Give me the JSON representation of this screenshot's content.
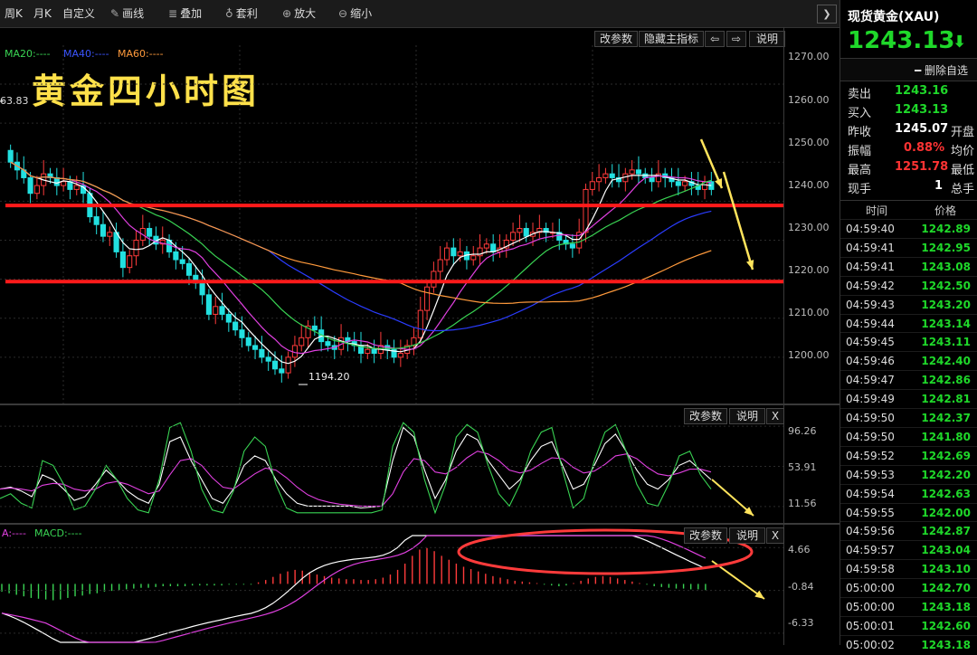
{
  "toolbar": {
    "weekly": "周K",
    "monthly": "月K",
    "custom": "自定义",
    "draw": "画线",
    "overlay": "叠加",
    "arbitrage": "套利",
    "zoom_in": "放大",
    "zoom_out": "缩小"
  },
  "main_panel": {
    "buttons": {
      "params": "改参数",
      "hide_indicator": "隐藏主指标",
      "explain": "说明"
    },
    "legend": {
      "ma20": "MA20:----",
      "ma40": "MA40:----",
      "ma60": "MA60:----"
    },
    "overlay_title": "黄金四小时图",
    "high_label": "63.83",
    "low_label": "1194.20"
  },
  "kd_panel": {
    "buttons": {
      "params": "改参数",
      "explain": "说明",
      "close": "X"
    },
    "y_ticks": [
      "96.26",
      "53.91",
      "11.56"
    ]
  },
  "macd_panel": {
    "buttons": {
      "params": "改参数",
      "explain": "说明",
      "close": "X"
    },
    "legend": {
      "a": "A:----",
      "macd": "MACD:----"
    },
    "y_ticks": [
      "4.66",
      "-0.84",
      "-6.33"
    ]
  },
  "colors": {
    "up": "#ff3b3b",
    "down": "#22e0e0",
    "ma20": "#39d353",
    "ma40": "#2a3cff",
    "ma60": "#ff9a3c",
    "fast": "#ffffff",
    "slow": "#e040e0",
    "green": "#39d353",
    "hline": "#ff1a1a",
    "arrow": "#ffe45c"
  },
  "quote": {
    "name": "现货黄金(XAU)",
    "price": "1243.13",
    "direction_icon": "arrow-down-icon",
    "remove_watch": "删除自选",
    "rows": [
      {
        "label": "卖出",
        "value": "1243.16",
        "extra": ""
      },
      {
        "label": "买入",
        "value": "1243.13",
        "extra": ""
      },
      {
        "label": "昨收",
        "value": "1245.07",
        "extra": "开盘"
      },
      {
        "label": "振幅",
        "value": "0.88%",
        "extra": "均价"
      },
      {
        "label": "最高",
        "value": "1251.78",
        "extra": "最低"
      },
      {
        "label": "现手",
        "value": "1",
        "extra": "总手"
      }
    ],
    "ticks_header": {
      "time": "时间",
      "price": "价格"
    },
    "ticks": [
      [
        "04:59:40",
        "1242.89"
      ],
      [
        "04:59:41",
        "1242.95"
      ],
      [
        "04:59:41",
        "1243.08"
      ],
      [
        "04:59:42",
        "1242.50"
      ],
      [
        "04:59:43",
        "1243.20"
      ],
      [
        "04:59:44",
        "1243.14"
      ],
      [
        "04:59:45",
        "1243.11"
      ],
      [
        "04:59:46",
        "1242.40"
      ],
      [
        "04:59:47",
        "1242.86"
      ],
      [
        "04:59:49",
        "1242.81"
      ],
      [
        "04:59:50",
        "1242.37"
      ],
      [
        "04:59:50",
        "1241.80"
      ],
      [
        "04:59:52",
        "1242.69"
      ],
      [
        "04:59:53",
        "1242.20"
      ],
      [
        "04:59:54",
        "1242.63"
      ],
      [
        "04:59:55",
        "1242.00"
      ],
      [
        "04:59:56",
        "1242.87"
      ],
      [
        "04:59:57",
        "1243.04"
      ],
      [
        "04:59:58",
        "1243.10"
      ],
      [
        "05:00:00",
        "1242.70"
      ],
      [
        "05:00:00",
        "1243.18"
      ],
      [
        "05:00:01",
        "1242.60"
      ],
      [
        "05:00:02",
        "1243.18"
      ]
    ]
  },
  "chart_data": [
    {
      "type": "candlestick",
      "y_ticks": [
        "1270.00",
        "1260.00",
        "1250.00",
        "1240.00",
        "1230.00",
        "1220.00",
        "1210.00",
        "1200.00"
      ],
      "ylim": [
        1190,
        1273
      ],
      "horizontal_lines": [
        1238.9,
        1219.4
      ],
      "series_names": [
        "MA20",
        "MA40",
        "MA60"
      ],
      "closes": [
        1250,
        1248,
        1246,
        1242,
        1244,
        1247,
        1246,
        1244,
        1245,
        1243,
        1244,
        1242,
        1236,
        1234,
        1231,
        1232,
        1227,
        1223,
        1226,
        1230,
        1233,
        1231,
        1229,
        1230,
        1227,
        1225,
        1224,
        1221,
        1219,
        1216,
        1211,
        1213,
        1211,
        1209,
        1207,
        1205,
        1203,
        1202,
        1200,
        1199,
        1197,
        1196,
        1200,
        1203,
        1205,
        1208,
        1207,
        1204,
        1203,
        1202,
        1205,
        1204,
        1203,
        1201,
        1202,
        1201,
        1203,
        1202,
        1200,
        1201,
        1203,
        1205,
        1212,
        1218,
        1222,
        1225,
        1228,
        1226,
        1227,
        1225,
        1226,
        1228,
        1229,
        1227,
        1228,
        1230,
        1232,
        1233,
        1231,
        1232,
        1233,
        1232,
        1232,
        1230,
        1229,
        1228,
        1232,
        1243,
        1245,
        1246,
        1247,
        1246,
        1245,
        1247,
        1248,
        1247,
        1246,
        1245,
        1247,
        1246,
        1245,
        1244,
        1245,
        1244,
        1243,
        1245,
        1243
      ]
    },
    {
      "type": "line",
      "name": "kd",
      "y_ticks": [
        "96.26",
        "53.91",
        "11.56"
      ],
      "ylim": [
        0,
        105
      ],
      "series": [
        {
          "name": "fast",
          "values": [
            30,
            32,
            28,
            22,
            45,
            40,
            30,
            18,
            22,
            35,
            50,
            40,
            28,
            20,
            15,
            35,
            80,
            85,
            60,
            40,
            20,
            15,
            30,
            55,
            65,
            60,
            40,
            25,
            15,
            12,
            12,
            12,
            12,
            12,
            10,
            11,
            12,
            60,
            95,
            85,
            50,
            20,
            40,
            70,
            88,
            82,
            60,
            45,
            30,
            40,
            60,
            75,
            80,
            55,
            30,
            35,
            55,
            78,
            88,
            70,
            50,
            35,
            30,
            40,
            55,
            60,
            50,
            40
          ]
        },
        {
          "name": "slow",
          "values": [
            30,
            31,
            30,
            28,
            34,
            36,
            35,
            30,
            28,
            30,
            36,
            38,
            35,
            30,
            25,
            28,
            45,
            60,
            62,
            55,
            42,
            32,
            30,
            38,
            46,
            52,
            50,
            42,
            32,
            24,
            19,
            16,
            14,
            13,
            12,
            12,
            12,
            25,
            48,
            62,
            60,
            48,
            46,
            53,
            63,
            70,
            67,
            60,
            50,
            47,
            50,
            57,
            63,
            62,
            53,
            47,
            49,
            56,
            65,
            67,
            62,
            53,
            46,
            44,
            47,
            51,
            51,
            48
          ]
        },
        {
          "name": "green",
          "values": [
            20,
            25,
            15,
            10,
            60,
            55,
            35,
            8,
            12,
            30,
            55,
            40,
            20,
            8,
            5,
            40,
            95,
            100,
            70,
            30,
            8,
            5,
            28,
            70,
            85,
            75,
            35,
            10,
            5,
            5,
            5,
            5,
            5,
            5,
            5,
            5,
            8,
            75,
            100,
            90,
            40,
            5,
            35,
            85,
            98,
            90,
            55,
            25,
            12,
            35,
            70,
            90,
            95,
            50,
            10,
            20,
            60,
            90,
            98,
            70,
            35,
            15,
            12,
            35,
            65,
            70,
            45,
            30
          ]
        }
      ]
    },
    {
      "type": "bar",
      "name": "macd",
      "y_ticks": [
        "4.66",
        "-0.84",
        "-6.33"
      ],
      "ylim": [
        -7.5,
        6.2
      ],
      "series_names": [
        "A",
        "MACD"
      ],
      "hist": [
        -1,
        -1.2,
        -1.4,
        -1.6,
        -1.8,
        -1.9,
        -2,
        -2.1,
        -2,
        -1.8,
        -1.6,
        -1.5,
        -1.3,
        -1.2,
        -1,
        -0.9,
        -0.8,
        -0.7,
        -0.6,
        -0.5,
        -0.5,
        -0.4,
        -0.3,
        -0.3,
        -0.3,
        -0.3,
        -0.2,
        -0.2,
        -0.2,
        -0.2,
        -0.2,
        -0.1,
        -0.1,
        -0.1,
        -0.1,
        0.2,
        0.5,
        0.9,
        1.3,
        1.6,
        1.8,
        1.7,
        1.5,
        1.2,
        1,
        0.8,
        0.7,
        0.6,
        0.6,
        0.5,
        0.5,
        0.6,
        0.8,
        1.2,
        1.8,
        2.6,
        3.6,
        4.4,
        4.6,
        4.2,
        3.6,
        3.1,
        2.6,
        2.2,
        1.9,
        1.6,
        1.3,
        1,
        0.8,
        0.6,
        0.4,
        0.3,
        0.2,
        0.1,
        -0.1,
        -0.2,
        -0.3,
        -0.2,
        0.1,
        0.4,
        0.7,
        0.9,
        1,
        0.9,
        0.7,
        0.5,
        0.3,
        0.1,
        -0.1,
        -0.3,
        -0.4,
        -0.5,
        -0.6,
        -0.6,
        -0.7,
        -0.7,
        -0.8
      ]
    }
  ]
}
